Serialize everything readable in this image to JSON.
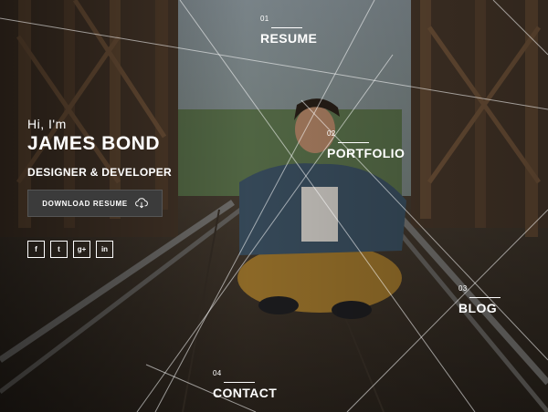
{
  "hero": {
    "greeting": "Hi, I'm",
    "name": "JAMES BOND",
    "role": "DESIGNER & DEVELOPER",
    "download_label": "DOWNLOAD RESUME"
  },
  "socials": [
    {
      "icon": "facebook-icon",
      "glyph": "f"
    },
    {
      "icon": "twitter-icon",
      "glyph": "t"
    },
    {
      "icon": "google-plus-icon",
      "glyph": "g+"
    },
    {
      "icon": "linkedin-icon",
      "glyph": "in"
    }
  ],
  "nav": [
    {
      "number": "01",
      "label": "RESUME"
    },
    {
      "number": "02",
      "label": "PORTFOLIO"
    },
    {
      "number": "03",
      "label": "BLOG"
    },
    {
      "number": "04",
      "label": "CONTACT"
    }
  ],
  "colors": {
    "accent": "#ffffff",
    "button_bg": "#3b3b3b"
  }
}
